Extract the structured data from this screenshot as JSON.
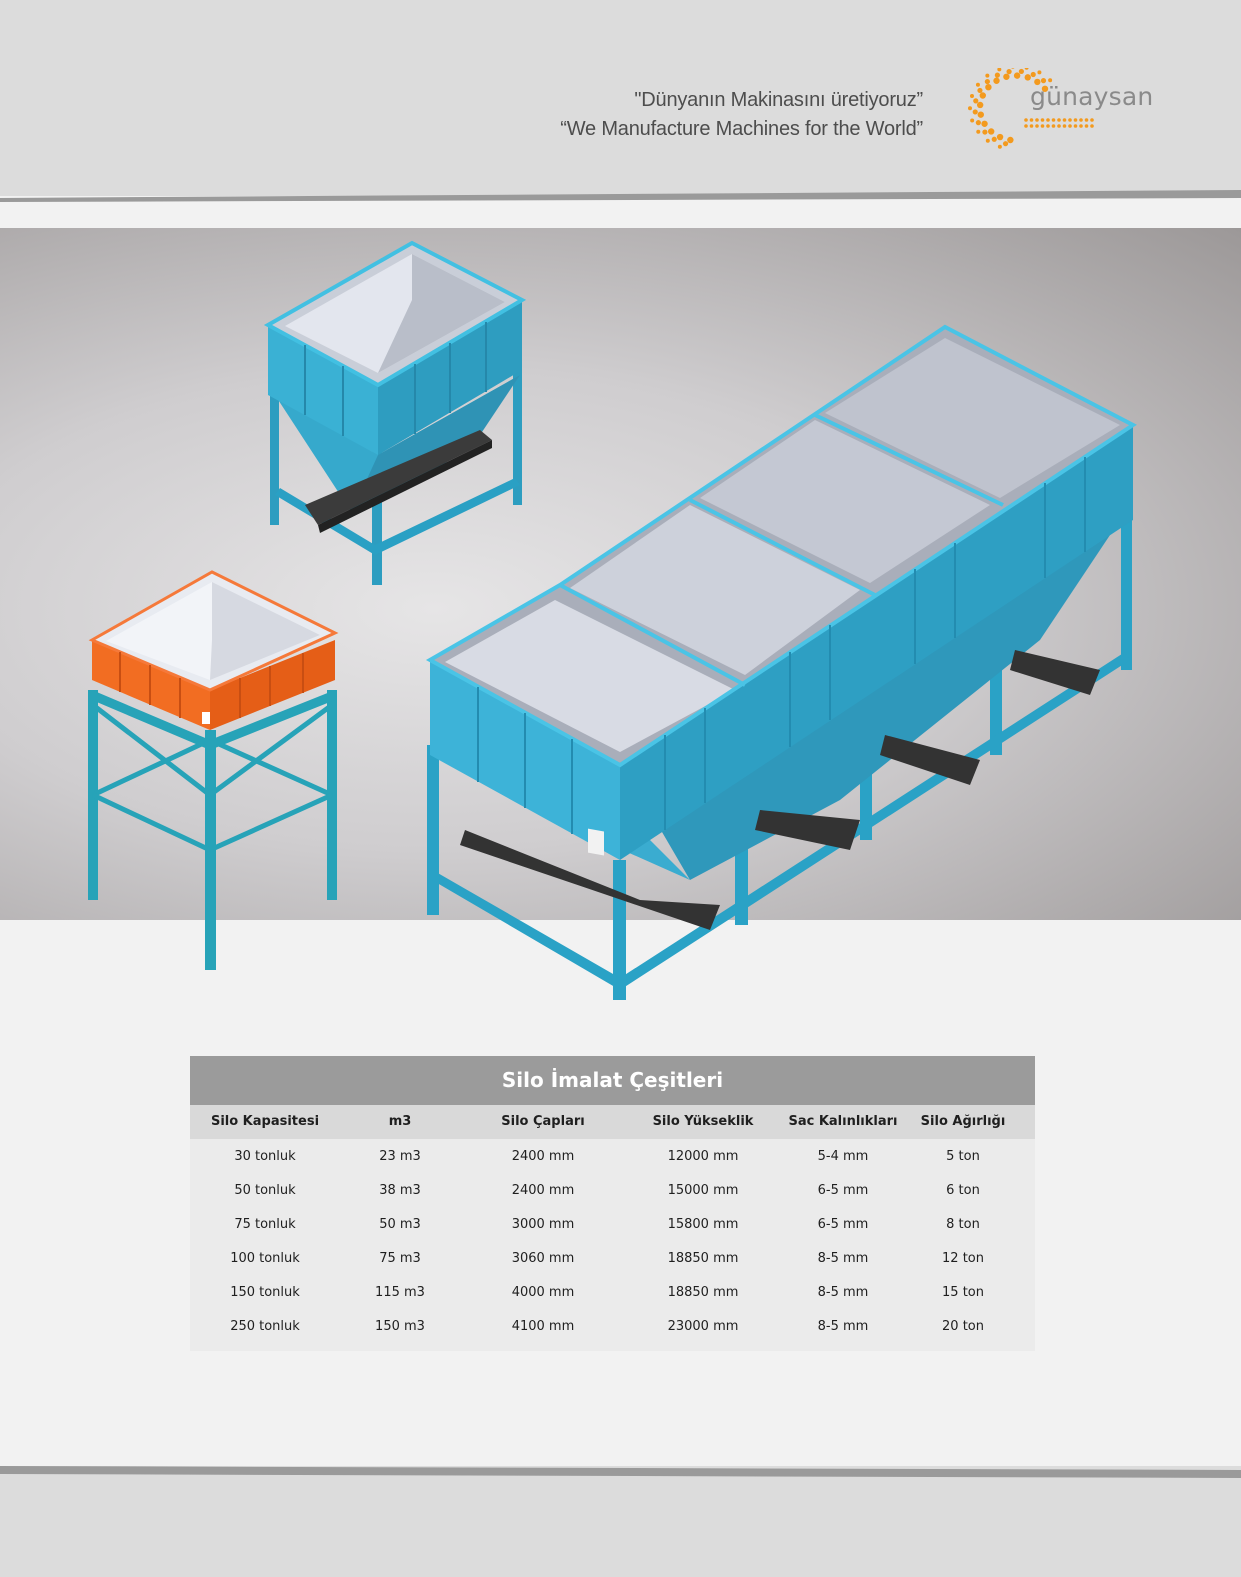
{
  "header": {
    "slogan_tr": "\"Dünyanın Makinasını üretiyoruz”",
    "slogan_en": "“We Manufacture Machines for the World”",
    "logo_text": "günaysan",
    "logo_color": "#f39a1e"
  },
  "colors": {
    "silo_blue": "#3db3d4",
    "silo_orange": "#f06a22",
    "table_title_bg": "#9b9b9b",
    "table_header_bg": "#d9d9d9"
  },
  "table": {
    "title": "Silo İmalat Çeşitleri",
    "columns": [
      "Silo Kapasitesi",
      "m3",
      "Silo Çapları",
      "Silo Yükseklik",
      "Sac Kalınlıkları",
      "Silo Ağırlığı"
    ],
    "rows": [
      [
        "30 tonluk",
        "23 m3",
        "2400 mm",
        "12000 mm",
        "5-4 mm",
        "5 ton"
      ],
      [
        "50 tonluk",
        "38 m3",
        "2400 mm",
        "15000 mm",
        "6-5 mm",
        "6 ton"
      ],
      [
        "75 tonluk",
        "50 m3",
        "3000 mm",
        "15800 mm",
        "6-5 mm",
        "8 ton"
      ],
      [
        "100 tonluk",
        "75 m3",
        "3060 mm",
        "18850 mm",
        "8-5 mm",
        "12 ton"
      ],
      [
        "150 tonluk",
        "115 m3",
        "4000 mm",
        "18850 mm",
        "8-5 mm",
        "15 ton"
      ],
      [
        "250 tonluk",
        "150 m3",
        "4100 mm",
        "23000 mm",
        "8-5 mm",
        "20 ton"
      ]
    ]
  }
}
